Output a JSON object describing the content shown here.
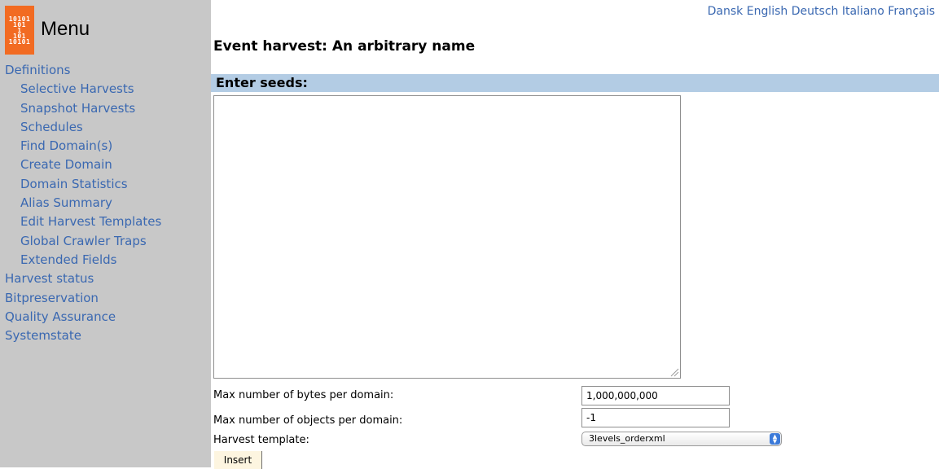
{
  "sidebar": {
    "logo_lines": [
      "10101",
      "101",
      "1",
      "101",
      "10101"
    ],
    "menu_title": "Menu",
    "items": [
      {
        "label": "Definitions",
        "level": 0
      },
      {
        "label": "Selective Harvests",
        "level": 1
      },
      {
        "label": "Snapshot Harvests",
        "level": 1
      },
      {
        "label": "Schedules",
        "level": 1
      },
      {
        "label": "Find Domain(s)",
        "level": 1
      },
      {
        "label": "Create Domain",
        "level": 1
      },
      {
        "label": "Domain Statistics",
        "level": 1
      },
      {
        "label": "Alias Summary",
        "level": 1
      },
      {
        "label": "Edit Harvest Templates",
        "level": 1
      },
      {
        "label": "Global Crawler Traps",
        "level": 1
      },
      {
        "label": "Extended Fields",
        "level": 1
      },
      {
        "label": "Harvest status",
        "level": 0
      },
      {
        "label": "Bitpreservation",
        "level": 0
      },
      {
        "label": "Quality Assurance",
        "level": 0
      },
      {
        "label": "Systemstate",
        "level": 0
      }
    ]
  },
  "languages": [
    "Dansk",
    "English",
    "Deutsch",
    "Italiano",
    "Français"
  ],
  "page": {
    "title": "Event harvest: An arbitrary name",
    "seeds_header": "Enter seeds:",
    "seeds_value": ""
  },
  "form": {
    "max_bytes_label": "Max number of bytes per domain:",
    "max_bytes_value": "1,000,000,000",
    "max_objects_label": "Max number of objects per domain:",
    "max_objects_value": "-1",
    "template_label": "Harvest template:",
    "template_selected": "3levels_orderxml",
    "insert_label": "Insert"
  },
  "colors": {
    "sidebar_bg": "#c8c8c8",
    "link": "#3a68b1",
    "logo": "#f26b22",
    "section_header_bg": "#b3cce4",
    "button_bg": "#fdf5e0"
  }
}
